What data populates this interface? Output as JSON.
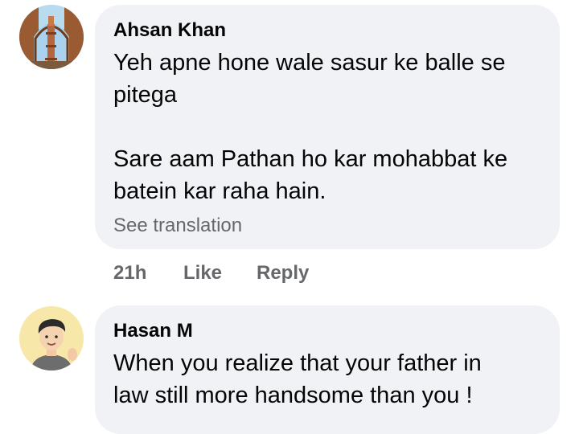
{
  "comments": [
    {
      "author": "Ahsan Khan",
      "avatar_icon": "qutub-minar-photo-avatar",
      "text": "Yeh apne hone wale sasur ke balle se\npitega\n\nSare aam Pathan ho kar mohabbat ke\nbatein kar raha hain.",
      "see_translation": "See translation",
      "time": "21h",
      "like_label": "Like",
      "reply_label": "Reply"
    },
    {
      "author": "Hasan M",
      "avatar_icon": "cartoon-man-avatar",
      "text": "When you realize that your father in\nlaw still more handsome than you !"
    }
  ],
  "colors": {
    "bubble": "#f0f2f5",
    "text": "#050505",
    "secondary": "#65676b"
  }
}
